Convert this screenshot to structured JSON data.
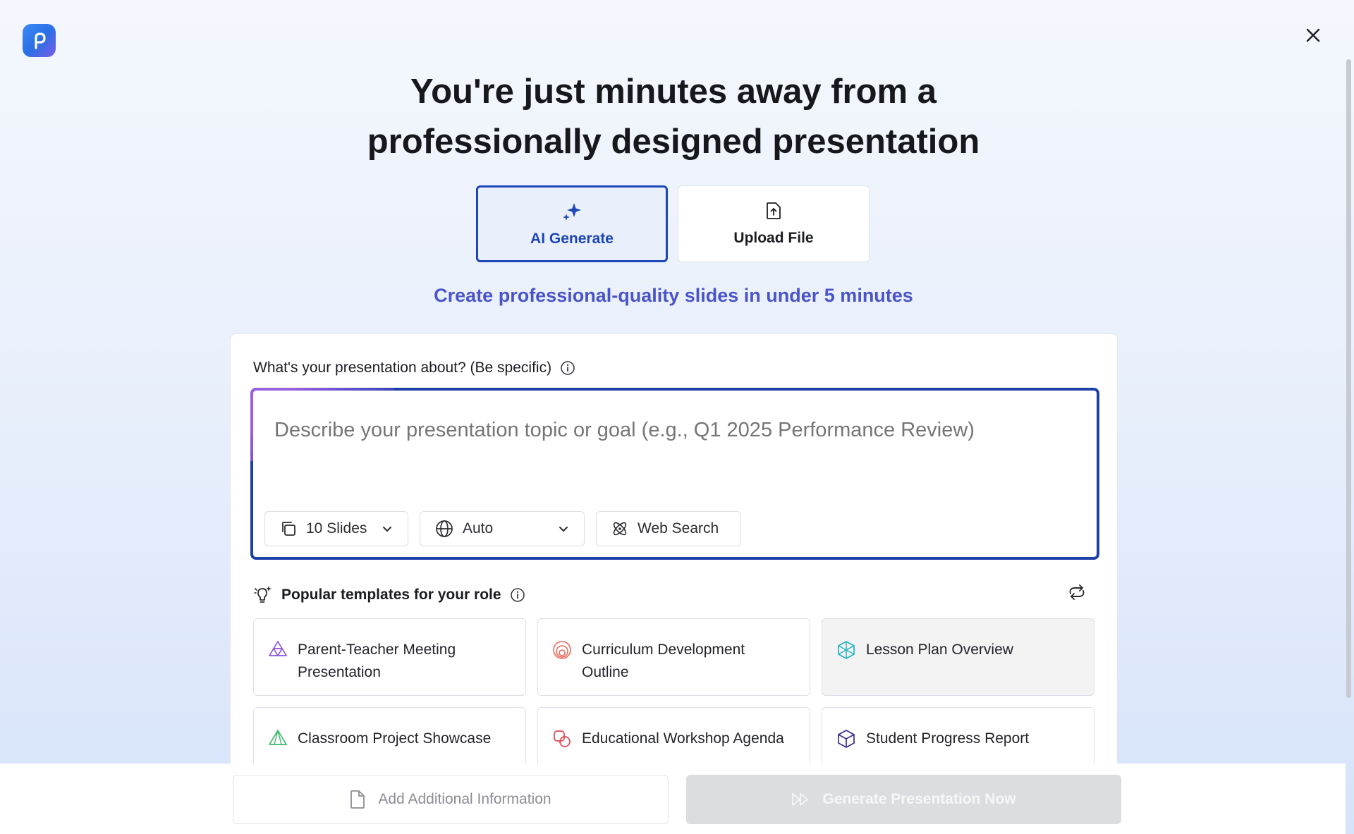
{
  "header": {
    "title_line1": "You're just minutes away from a",
    "title_line2": "professionally designed presentation"
  },
  "mode_tabs": [
    {
      "label": "AI Generate",
      "icon": "sparkle-icon",
      "active": true
    },
    {
      "label": "Upload File",
      "icon": "file-upload-icon",
      "active": false
    }
  ],
  "tagline": "Create professional-quality slides in under 5 minutes",
  "prompt": {
    "label": "What's your presentation about? (Be specific)",
    "placeholder": "Describe your presentation topic or goal (e.g., Q1 2025 Performance Review)",
    "value": ""
  },
  "options": {
    "slides": "10 Slides",
    "language": "Auto",
    "web_search": "Web Search"
  },
  "templates": {
    "heading": "Popular templates for your role",
    "items": [
      {
        "label": "Parent-Teacher Meeting Presentation",
        "icon": "triangles-icon",
        "color": "#8e55d9"
      },
      {
        "label": "Curriculum Development Outline",
        "icon": "rainbow-arcs-icon",
        "color": "#e9685c"
      },
      {
        "label": "Lesson Plan Overview",
        "icon": "hexagon-star-icon",
        "color": "#22b3c4"
      },
      {
        "label": "Classroom Project Showcase",
        "icon": "triangle-layers-icon",
        "color": "#3fb56d"
      },
      {
        "label": "Educational Workshop Agenda",
        "icon": "overlapping-squares-icon",
        "color": "#e0434b"
      },
      {
        "label": "Student Progress Report",
        "icon": "cube-icon",
        "color": "#3b2a8f"
      }
    ]
  },
  "footer": {
    "add_info": "Add Additional Information",
    "generate": "Generate Presentation Now"
  },
  "colors": {
    "accent": "#1d46b6",
    "tagline": "#4a54c8",
    "disabled": "#dcdde0"
  }
}
